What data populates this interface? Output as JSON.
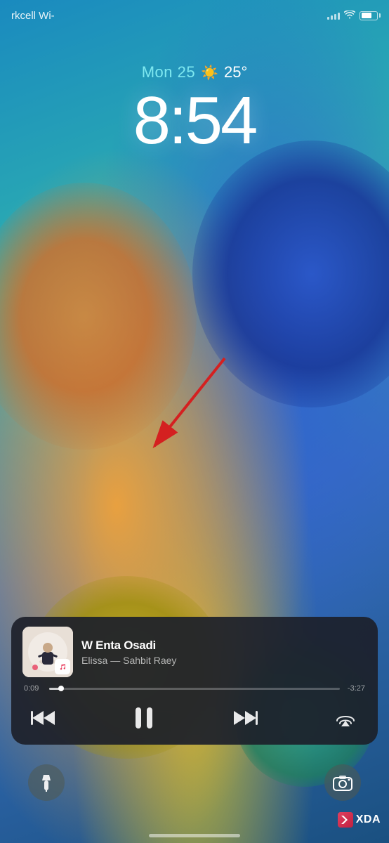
{
  "status": {
    "carrier": "rkcell Wi-",
    "time_display": "8:54",
    "battery_level": 70
  },
  "lock_screen": {
    "date": "Mon 25",
    "weather_symbol": "☀️",
    "temperature": "25°",
    "time": "8:54"
  },
  "music_widget": {
    "song_title": "W Enta Osadi",
    "artist": "Elissa",
    "album": "Sahbit Raey",
    "artist_album": "Elissa — Sahbit Raey",
    "current_time": "0:09",
    "remaining_time": "-3:27",
    "progress_percent": 4
  },
  "controls": {
    "rewind": "«",
    "pause": "⏸",
    "fast_forward": "»",
    "airplay": "airplay"
  },
  "bottom": {
    "flashlight_label": "flashlight",
    "camera_label": "camera"
  },
  "watermark": {
    "text": "XDA"
  }
}
